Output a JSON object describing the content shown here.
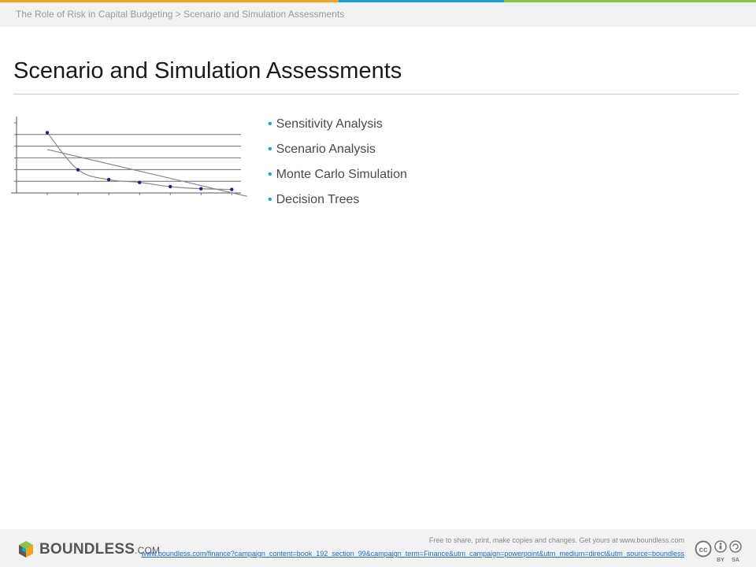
{
  "header": {
    "breadcrumb": "The Role of Risk in Capital Budgeting > Scenario and Simulation Assessments",
    "stripe_colors": [
      "#f2a21b",
      "#1a9fd9",
      "#8cc63f"
    ]
  },
  "slide": {
    "title": "Scenario and Simulation Assessments",
    "bullets": [
      "Sensitivity Analysis",
      "Scenario Analysis",
      "Monte Carlo Simulation",
      "Decision Trees"
    ]
  },
  "chart_data": {
    "type": "scatter",
    "series": [
      {
        "values": [
          [
            1,
            86
          ],
          [
            2,
            33
          ],
          [
            3,
            19
          ],
          [
            4,
            15
          ],
          [
            5,
            9
          ],
          [
            6,
            6
          ],
          [
            7,
            5
          ]
        ]
      }
    ],
    "trendline": [
      [
        1,
        62
      ],
      [
        7.8,
        -8
      ]
    ],
    "xlim": [
      0,
      7.3
    ],
    "ylim": [
      0,
      100
    ],
    "grid": true,
    "colors": {
      "points": "#1a237e",
      "line": "#888888",
      "grid": "#555555"
    }
  },
  "footer": {
    "logo_text": "BOUNDLESS",
    "logo_suffix": ".COM",
    "license_text": "Free to share, print, make copies and changes. Get yours at www.boundless.com",
    "url": "www.boundless.com/finance?campaign_content=book_192_section_99&campaign_term=Finance&utm_campaign=powerpoint&utm_medium=direct&utm_source=boundless",
    "cc_badges": [
      "BY",
      "SA"
    ]
  }
}
